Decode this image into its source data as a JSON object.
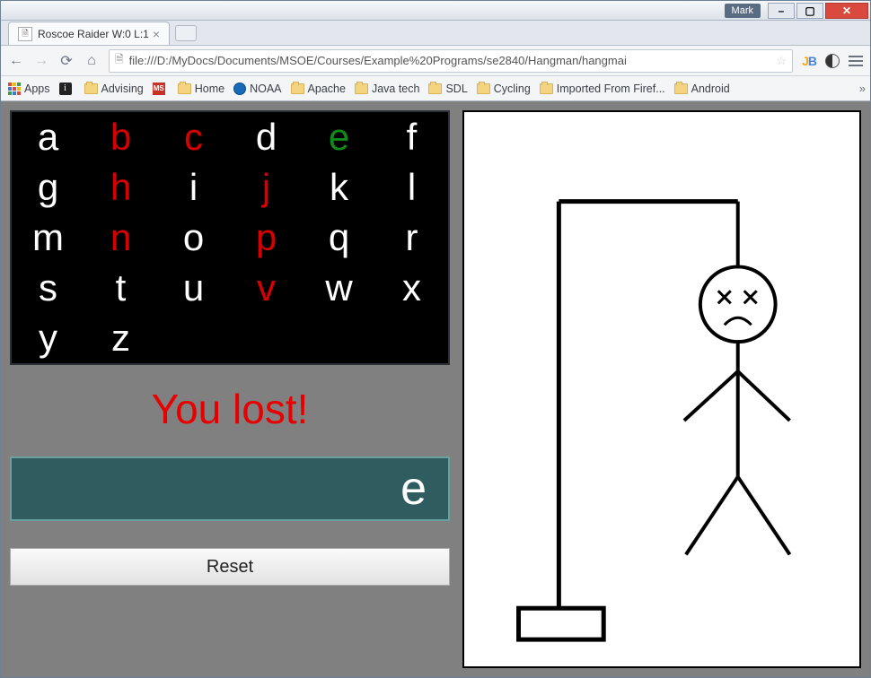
{
  "window": {
    "user_label": "Mark",
    "min_symbol": "–",
    "max_symbol": "▢",
    "close_symbol": "✕"
  },
  "tab": {
    "title": "Roscoe Raider W:0 L:1",
    "close_symbol": "×"
  },
  "address": {
    "url": "file:///D:/MyDocs/Documents/MSOE/Courses/Example%20Programs/se2840/Hangman/hangmai",
    "doc_icon": "🗎",
    "star": "☆"
  },
  "extensions": {
    "jb_j": "J",
    "jb_b": "B"
  },
  "bookmarks": {
    "apps": "Apps",
    "i_label": "",
    "advising": "Advising",
    "ms_label": "",
    "home": "Home",
    "noaa": "NOAA",
    "apache": "Apache",
    "javatech": "Java tech",
    "sdl": "SDL",
    "cycling": "Cycling",
    "imported": "Imported From Firef...",
    "android": "Android",
    "chevrons": "»"
  },
  "game": {
    "letters": [
      {
        "ch": "a",
        "state": "white"
      },
      {
        "ch": "b",
        "state": "wrong"
      },
      {
        "ch": "c",
        "state": "wrong"
      },
      {
        "ch": "d",
        "state": "white"
      },
      {
        "ch": "e",
        "state": "correct"
      },
      {
        "ch": "f",
        "state": "white"
      },
      {
        "ch": "g",
        "state": "white"
      },
      {
        "ch": "h",
        "state": "wrong"
      },
      {
        "ch": "i",
        "state": "white"
      },
      {
        "ch": "j",
        "state": "wrong"
      },
      {
        "ch": "k",
        "state": "white"
      },
      {
        "ch": "l",
        "state": "white"
      },
      {
        "ch": "m",
        "state": "white"
      },
      {
        "ch": "n",
        "state": "wrong"
      },
      {
        "ch": "o",
        "state": "white"
      },
      {
        "ch": "p",
        "state": "wrong"
      },
      {
        "ch": "q",
        "state": "white"
      },
      {
        "ch": "r",
        "state": "white"
      },
      {
        "ch": "s",
        "state": "white"
      },
      {
        "ch": "t",
        "state": "white"
      },
      {
        "ch": "u",
        "state": "white"
      },
      {
        "ch": "v",
        "state": "wrong"
      },
      {
        "ch": "w",
        "state": "white"
      },
      {
        "ch": "x",
        "state": "white"
      },
      {
        "ch": "y",
        "state": "white"
      },
      {
        "ch": "z",
        "state": "white"
      }
    ],
    "status_message": "You lost!",
    "revealed_word": "e",
    "reset_label": "Reset"
  }
}
